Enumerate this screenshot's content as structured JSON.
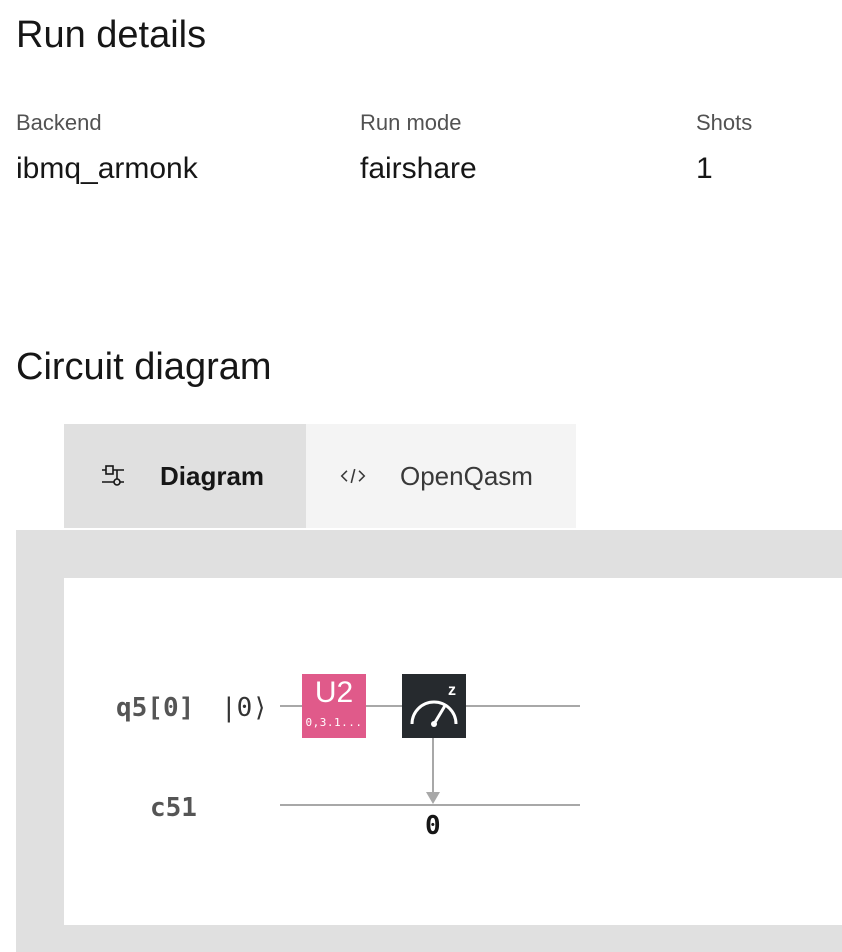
{
  "run_details": {
    "title": "Run details",
    "backend": {
      "label": "Backend",
      "value": "ibmq_armonk"
    },
    "run_mode": {
      "label": "Run mode",
      "value": "fairshare"
    },
    "shots": {
      "label": "Shots",
      "value": "1"
    }
  },
  "circuit": {
    "title": "Circuit diagram",
    "tabs": [
      {
        "label": "Diagram",
        "icon": "circuit-icon",
        "active": true
      },
      {
        "label": "OpenQasm",
        "icon": "code-icon",
        "active": false
      }
    ],
    "qubit": {
      "label": "q5[0]",
      "initial_state": "|0⟩"
    },
    "classical_register": {
      "label": "c51"
    },
    "gates": [
      {
        "name": "U2",
        "params": "0,3.1...",
        "color": "#e05a8a"
      },
      {
        "name": "measure",
        "icon": "measure-z-icon",
        "basis": "z",
        "target_bit": "0",
        "color": "#262a2e"
      }
    ]
  }
}
